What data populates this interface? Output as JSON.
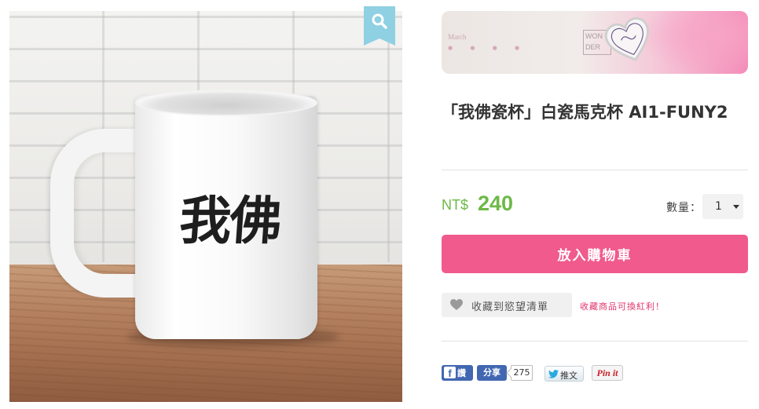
{
  "product": {
    "image_text": "我佛",
    "title": "「我佛瓷杯」白瓷馬克杯 AI1-FUNY2",
    "price_currency": "NT$",
    "price_value": "240"
  },
  "banner": {
    "month": "March",
    "wordmark": "WON DER"
  },
  "quantity": {
    "label": "數量：",
    "value": "1"
  },
  "actions": {
    "add_to_cart": "放入購物車",
    "wishlist": "收藏到慾望清單",
    "wishlist_note": "收藏商品可換紅利！"
  },
  "social": {
    "fb_like": "讚",
    "fb_share": "分享",
    "fb_count": "275",
    "tweet": "推文",
    "pinit": "Pin it"
  },
  "icons": {
    "zoom": "search-icon",
    "wishlist": "heart-icon",
    "facebook": "facebook-icon",
    "twitter": "twitter-bird-icon"
  },
  "colors": {
    "price_green": "#6cb947",
    "cart_pink": "#f05a8d",
    "note_red": "#e2336b",
    "facebook_blue": "#4267b2",
    "zoom_tag_blue": "#8fd0e3"
  }
}
